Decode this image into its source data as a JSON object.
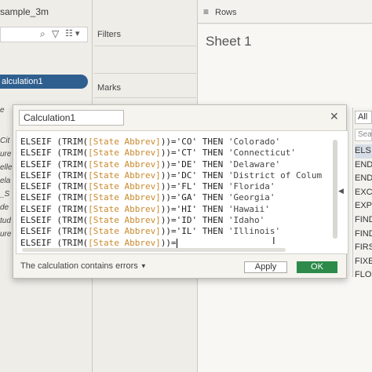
{
  "left_pane": {
    "source_title": "sample_3m",
    "selected_field": "alculation1",
    "partial_fields": [
      "e",
      "Cit",
      "ure",
      "ellec",
      "ela",
      "_S",
      "de",
      "tud",
      "ure"
    ]
  },
  "middle_pane": {
    "filters_label": "Filters",
    "marks_label": "Marks"
  },
  "shelves": {
    "rows_label": "Rows"
  },
  "sheet": {
    "title": "Sheet 1"
  },
  "dialog": {
    "calc_name": "Calculation1",
    "close_glyph": "✕",
    "lines": [
      {
        "kw": "ELSEIF (TRIM(",
        "field": "[State Abbrev]",
        "op": "))='CO' THEN ",
        "str": "'Colorado'"
      },
      {
        "kw": "ELSEIF (TRIM(",
        "field": "[State Abbrev]",
        "op": "))='CT' THEN ",
        "str": "'Connecticut'"
      },
      {
        "kw": "ELSEIF (TRIM(",
        "field": "[State Abbrev]",
        "op": "))='DE' THEN ",
        "str": "'Delaware'"
      },
      {
        "kw": "ELSEIF (TRIM(",
        "field": "[State Abbrev]",
        "op": "))='DC' THEN ",
        "str": "'District of Colum"
      },
      {
        "kw": "ELSEIF (TRIM(",
        "field": "[State Abbrev]",
        "op": "))='FL' THEN ",
        "str": "'Florida'"
      },
      {
        "kw": "ELSEIF (TRIM(",
        "field": "[State Abbrev]",
        "op": "))='GA' THEN ",
        "str": "'Georgia'"
      },
      {
        "kw": "ELSEIF (TRIM(",
        "field": "[State Abbrev]",
        "op": "))='HI' THEN ",
        "str": "'Hawaii'"
      },
      {
        "kw": "ELSEIF (TRIM(",
        "field": "[State Abbrev]",
        "op": "))='ID' THEN ",
        "str": "'Idaho'"
      },
      {
        "kw": "ELSEIF (TRIM(",
        "field": "[State Abbrev]",
        "op": "))='IL' THEN ",
        "str": "'Illinois'"
      },
      {
        "kw": "ELSEIF (TRIM(",
        "field": "[State Abbrev]",
        "op": "))=",
        "str": ""
      }
    ],
    "errors_label": "The calculation contains errors",
    "apply_label": "Apply",
    "ok_label": "OK"
  },
  "functions": {
    "dropdown": "All",
    "search_placeholder": "Sea",
    "items": [
      "ELS",
      "END",
      "END",
      "EXC",
      "EXP",
      "FIND",
      "FIND",
      "FIRS",
      "FIXE",
      "FLO"
    ]
  },
  "colors": {
    "field_reference": "#c98a2e",
    "ok_button": "#2d8a4a",
    "selected_field": "#2f5f8f"
  }
}
